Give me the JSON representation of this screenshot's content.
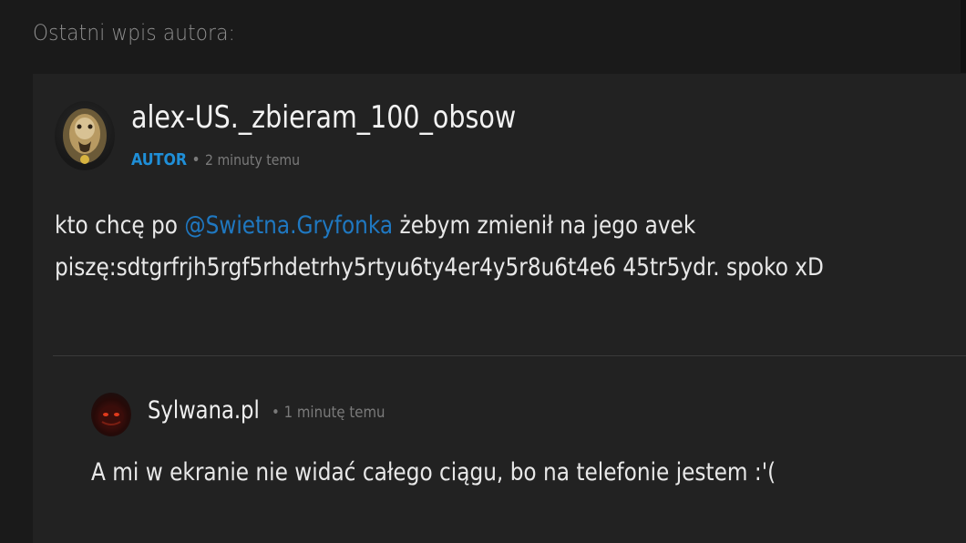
{
  "section": {
    "heading": "Ostatni wpis autora:"
  },
  "post": {
    "author": "alex-US._zbieram_100_obsow",
    "badge": "AUTOR",
    "separator": "•",
    "time": "2 minuty temu",
    "body_line1_before": "kto chcę po ",
    "mention": "@Swietna.Gryfonka",
    "body_line1_after": " żebym zmienił na jego avek",
    "body_line2": "piszę:sdtgrfrjh5rgf5rhdetrhy5rtyu6ty4er4y5r8u6t4e6 45tr5ydr. spoko xD"
  },
  "reply": {
    "author": "Sylwana.pl",
    "separator": "•",
    "time": "1 minutę temu",
    "body": "A mi w ekranie nie widać całego ciągu, bo na telefonie jestem :'("
  },
  "icons": {
    "author_avatar": "lion-avatar-icon",
    "reply_avatar": "dark-red-avatar-icon"
  },
  "colors": {
    "background": "#1a1a1a",
    "card": "#222222",
    "accent": "#1f8fd8",
    "mention": "#1f78c1",
    "muted": "#7a7a7a"
  }
}
